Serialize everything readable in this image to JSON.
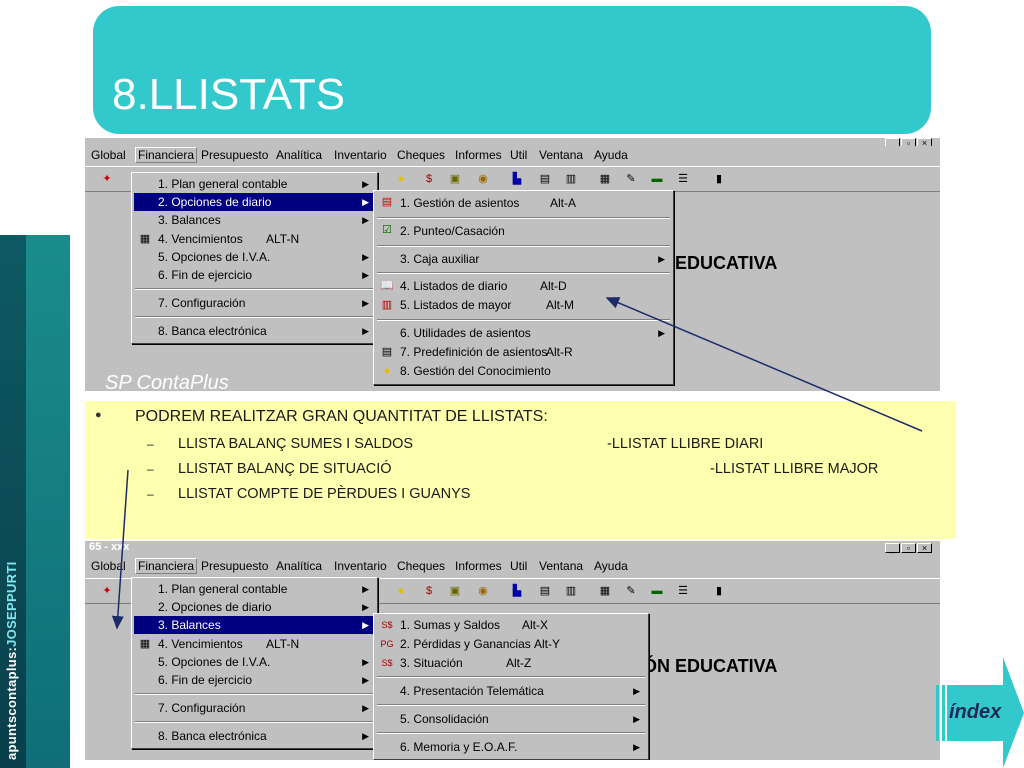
{
  "sidebar": {
    "credit_prefix": "apuntscontaplus:",
    "credit_name": "JOSEPPURTI"
  },
  "slide": {
    "title": "8.LLISTATS"
  },
  "screens": {
    "top": {
      "window_buttons": [
        "_",
        "▫",
        "×"
      ],
      "menubar": [
        "Global",
        "Financiera",
        "Presupuesto",
        "Analítica",
        "Inventario",
        "Cheques",
        "Informes",
        "Util",
        "Ventana",
        "Ayuda"
      ],
      "background_heading": "EDUCATIVA",
      "product_logo": "SP ContaPlus",
      "financiera_menu": [
        {
          "label": "1. Plan general contable",
          "shortcut": "",
          "submenu": true
        },
        {
          "label": "2. Opciones de diario",
          "shortcut": "",
          "submenu": true,
          "highlighted": true
        },
        {
          "label": "3. Balances",
          "shortcut": "",
          "submenu": true
        },
        {
          "label": "4. Vencimientos",
          "shortcut": "ALT-N",
          "submenu": false
        },
        {
          "label": "5. Opciones de I.V.A.",
          "shortcut": "",
          "submenu": true
        },
        {
          "label": "6. Fin de ejercicio",
          "shortcut": "",
          "submenu": true
        },
        {
          "label": "7. Configuración",
          "shortcut": "",
          "submenu": true
        },
        {
          "label": "8. Banca electrónica",
          "shortcut": "",
          "submenu": true
        }
      ],
      "submenu": [
        {
          "label": "1. Gestión de asientos",
          "shortcut": "Alt-A",
          "submenu": false
        },
        {
          "label": "2. Punteo/Casación",
          "shortcut": "",
          "submenu": false
        },
        {
          "label": "3. Caja auxiliar",
          "shortcut": "",
          "submenu": true
        },
        {
          "label": "4. Listados de diario",
          "shortcut": "Alt-D",
          "submenu": false
        },
        {
          "label": "5. Listados de mayor",
          "shortcut": "Alt-M",
          "submenu": false
        },
        {
          "label": "6. Utilidades de asientos",
          "shortcut": "",
          "submenu": true
        },
        {
          "label": "7. Predefinición de asientos",
          "shortcut": "Alt-R",
          "submenu": false
        },
        {
          "label": "8. Gestión del Conocimiento",
          "shortcut": "",
          "submenu": false
        }
      ]
    },
    "bottom": {
      "window_title": "65 - xxx",
      "window_buttons": [
        "_",
        "▫",
        "×"
      ],
      "menubar": [
        "Global",
        "Financiera",
        "Presupuesto",
        "Analítica",
        "Inventario",
        "Cheques",
        "Informes",
        "Util",
        "Ventana",
        "Ayuda"
      ],
      "background_heading": "ÓN EDUCATIVA",
      "financiera_menu": [
        {
          "label": "1. Plan general contable",
          "shortcut": "",
          "submenu": true
        },
        {
          "label": "2. Opciones de diario",
          "shortcut": "",
          "submenu": true
        },
        {
          "label": "3. Balances",
          "shortcut": "",
          "submenu": true,
          "highlighted": true
        },
        {
          "label": "4. Vencimientos",
          "shortcut": "ALT-N",
          "submenu": false
        },
        {
          "label": "5. Opciones de I.V.A.",
          "shortcut": "",
          "submenu": true
        },
        {
          "label": "6. Fin de ejercicio",
          "shortcut": "",
          "submenu": true
        },
        {
          "label": "7. Configuración",
          "shortcut": "",
          "submenu": true
        },
        {
          "label": "8. Banca electrónica",
          "shortcut": "",
          "submenu": true
        }
      ],
      "submenu": [
        {
          "label": "1. Sumas y Saldos",
          "shortcut": "Alt-X",
          "submenu": false
        },
        {
          "label": "2. Pérdidas y Ganancias",
          "shortcut": "Alt-Y",
          "submenu": false
        },
        {
          "label": "3. Situación",
          "shortcut": "Alt-Z",
          "submenu": false
        },
        {
          "label": "4. Presentación Telemática",
          "shortcut": "",
          "submenu": true
        },
        {
          "label": "5. Consolidación",
          "shortcut": "",
          "submenu": true
        },
        {
          "label": "6. Memoria y E.O.A.F.",
          "shortcut": "",
          "submenu": true
        }
      ]
    }
  },
  "notes": {
    "bullet": "PODREM REALITZAR GRAN QUANTITAT DE LLISTATS:",
    "items": [
      "LLISTA BALANÇ SUMES I SALDOS",
      "LLISTAT BALANÇ DE SITUACIÓ",
      "LLISTAT COMPTE DE PÈRDUES I GUANYS"
    ],
    "right_items": [
      "-LLISTAT LLIBRE DIARI",
      "-LLISTAT LLIBRE MAJOR"
    ],
    "dash": "–",
    "bullet_dot": "●"
  },
  "nav": {
    "index_label": "índex"
  },
  "colors": {
    "teal": "#33c9cc",
    "highlight": "#000080",
    "note_bg": "#ffffb0",
    "arrow": "#1c2a6b"
  }
}
